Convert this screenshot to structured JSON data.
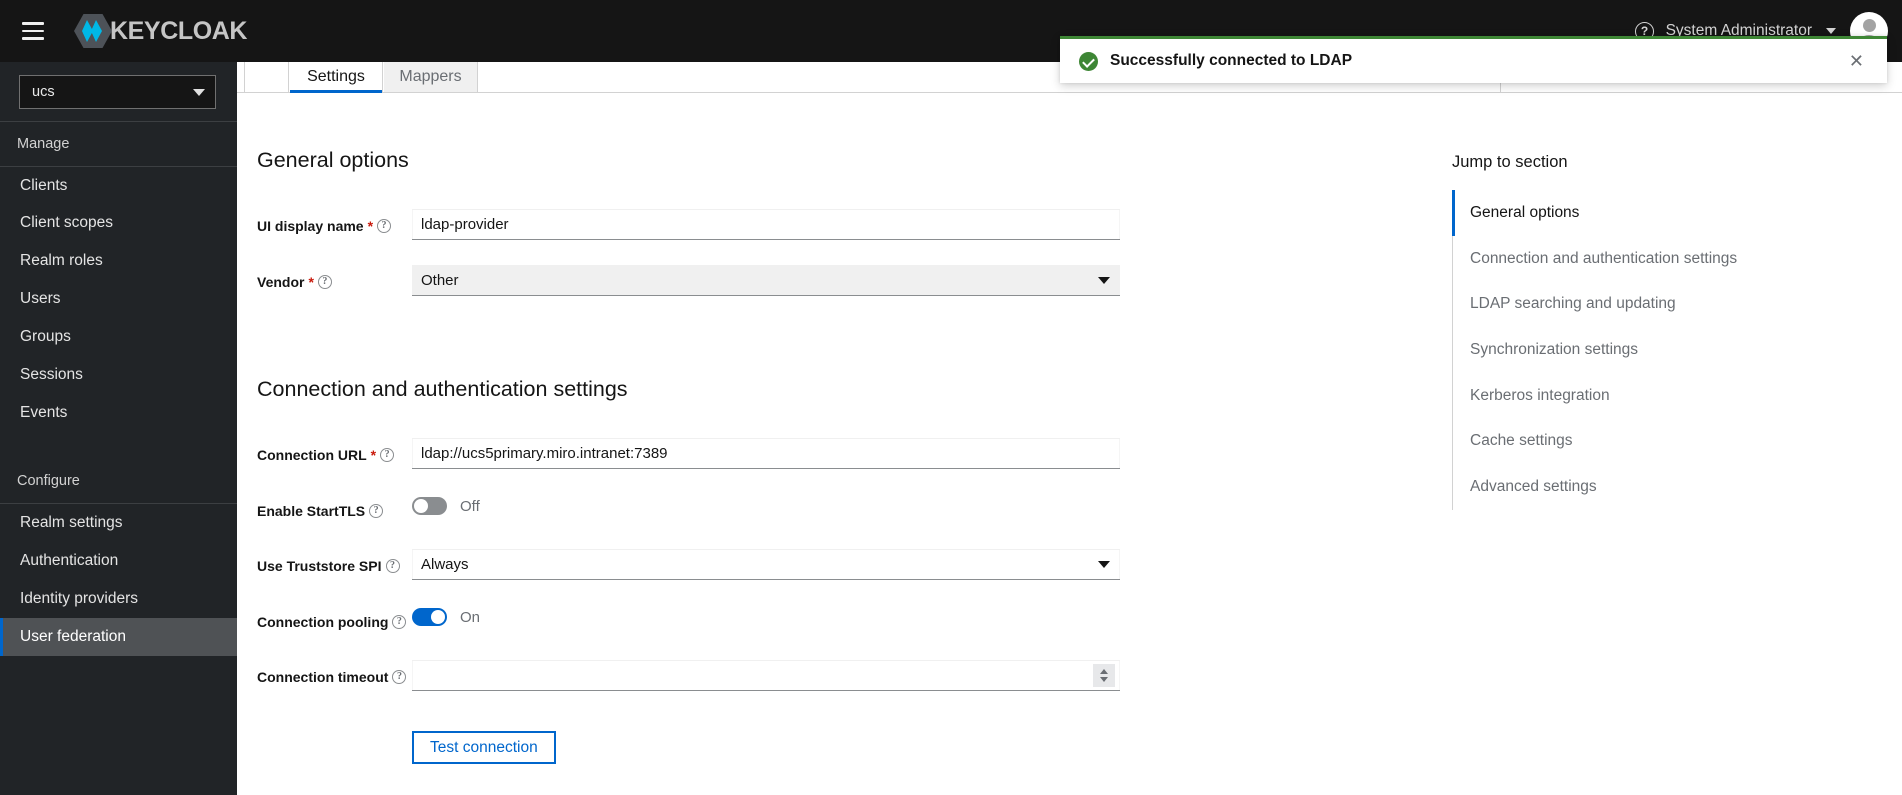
{
  "masthead": {
    "hamburger_name": "global-nav-toggle",
    "brand_text": "KEYCLOAK",
    "help_glyph": "?",
    "username": "System Administrator"
  },
  "alert": {
    "message": "Successfully connected to LDAP",
    "close_glyph": "✕",
    "accent_color": "#3e8635"
  },
  "sidebar": {
    "realm": {
      "value": "ucs"
    },
    "groups": [
      {
        "title": "Manage",
        "items": [
          {
            "label": "Clients",
            "active": false
          },
          {
            "label": "Client scopes",
            "active": false
          },
          {
            "label": "Realm roles",
            "active": false
          },
          {
            "label": "Users",
            "active": false
          },
          {
            "label": "Groups",
            "active": false
          },
          {
            "label": "Sessions",
            "active": false
          },
          {
            "label": "Events",
            "active": false
          }
        ]
      },
      {
        "title": "Configure",
        "items": [
          {
            "label": "Realm settings",
            "active": false
          },
          {
            "label": "Authentication",
            "active": false
          },
          {
            "label": "Identity providers",
            "active": false
          },
          {
            "label": "User federation",
            "active": true
          }
        ]
      }
    ]
  },
  "tabs": [
    {
      "label": "Settings",
      "active": true
    },
    {
      "label": "Mappers",
      "active": false
    }
  ],
  "form": {
    "sections": [
      {
        "title": "General options"
      },
      {
        "title": "Connection and authentication settings"
      }
    ],
    "ui_display_name": {
      "label": "UI display name",
      "required_marker": "*",
      "value": "ldap-provider"
    },
    "vendor": {
      "label": "Vendor",
      "required_marker": "*",
      "value": "Other"
    },
    "connection_url": {
      "label": "Connection URL",
      "required_marker": "*",
      "value": "ldap://ucs5primary.miro.intranet:7389"
    },
    "enable_starttls": {
      "label": "Enable StartTLS",
      "state": "Off",
      "on": false
    },
    "use_truststore_spi": {
      "label": "Use Truststore SPI",
      "value": "Always"
    },
    "connection_pooling": {
      "label": "Connection pooling",
      "state": "On",
      "on": true
    },
    "connection_timeout": {
      "label": "Connection timeout",
      "value": "",
      "placeholder": ""
    },
    "test_connection_button": "Test connection",
    "help_glyph": "?"
  },
  "jump": {
    "title": "Jump to section",
    "items": [
      {
        "label": "General options",
        "active": true
      },
      {
        "label": "Connection and authentication settings",
        "active": false
      },
      {
        "label": "LDAP searching and updating",
        "active": false
      },
      {
        "label": "Synchronization settings",
        "active": false
      },
      {
        "label": "Kerberos integration",
        "active": false
      },
      {
        "label": "Cache settings",
        "active": false
      },
      {
        "label": "Advanced settings",
        "active": false
      }
    ]
  }
}
